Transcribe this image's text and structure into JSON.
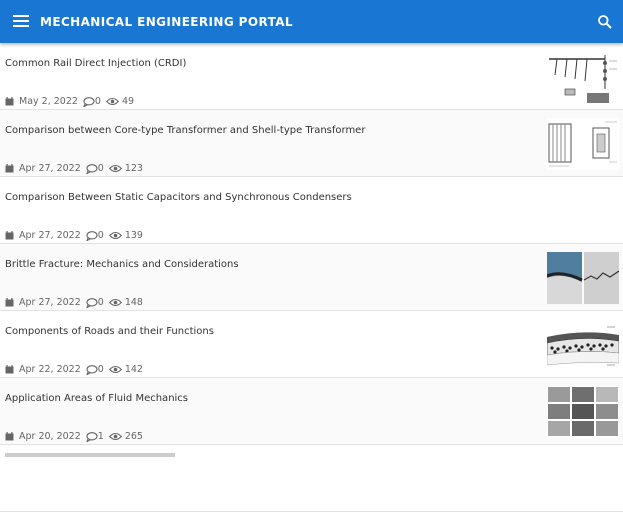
{
  "app": {
    "title": "MECHANICAL ENGINEERING PORTAL"
  },
  "articles": [
    {
      "title": "Common Rail Direct Injection (CRDI)",
      "date": "May 2, 2022",
      "comments": "0",
      "views": "49",
      "thumb": "crdi-diagram"
    },
    {
      "title": "Comparison between Core-type Transformer and Shell-type Transformer",
      "date": "Apr 27, 2022",
      "comments": "0",
      "views": "123",
      "thumb": "transformer-diagram"
    },
    {
      "title": "Comparison Between Static Capacitors and Synchronous Condensers",
      "date": "Apr 27, 2022",
      "comments": "0",
      "views": "139",
      "thumb": ""
    },
    {
      "title": "Brittle Fracture: Mechanics and Considerations",
      "date": "Apr 27, 2022",
      "comments": "0",
      "views": "148",
      "thumb": "fracture-photo"
    },
    {
      "title": "Components of Roads and their Functions",
      "date": "Apr 22, 2022",
      "comments": "0",
      "views": "142",
      "thumb": "road-layers-diagram"
    },
    {
      "title": "Application Areas of Fluid Mechanics",
      "date": "Apr 20, 2022",
      "comments": "1",
      "views": "265",
      "thumb": "fluid-applications-collage"
    }
  ],
  "colors": {
    "appbar": "#1976d2"
  }
}
